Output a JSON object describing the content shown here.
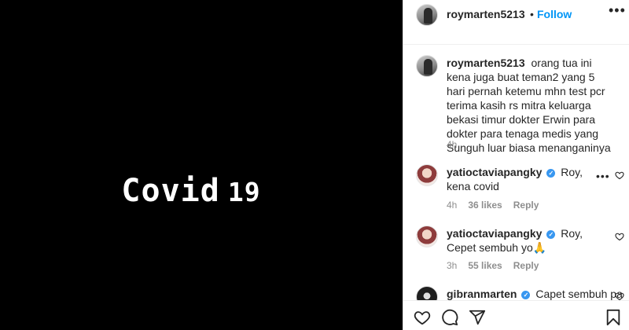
{
  "media": {
    "word": "Covid",
    "number": "19"
  },
  "header": {
    "username": "roymarten5213",
    "separator": "•",
    "follow_label": "Follow",
    "more_icon": "more-horizontal-icon"
  },
  "caption": {
    "username": "roymarten5213",
    "text": "orang tua ini kena juga buat teman2 yang 5 hari pernah ketemu mhn test pcr terima kasih rs mitra keluarga bekasi timur dokter Erwin para dokter para tenaga medis yang Sunguh luar biasa menanganinya",
    "time": "4h"
  },
  "comments": [
    {
      "username": "yatioctaviapangky",
      "verified": true,
      "text": "Roy, kena covid",
      "time": "4h",
      "likes": "36 likes",
      "reply": "Reply"
    },
    {
      "username": "yatioctaviapangky",
      "verified": true,
      "text": "Roy, Cepet sembuh yo🙏",
      "time": "3h",
      "likes": "55 likes",
      "reply": "Reply"
    },
    {
      "username": "gibranmarten",
      "verified": true,
      "text": "Capet sembuh pa",
      "time": "",
      "likes": "",
      "reply": ""
    }
  ],
  "action_icons": [
    "heart-icon",
    "comment-icon",
    "share-icon",
    "bookmark-icon"
  ],
  "colors": {
    "accent": "#0095f6",
    "verified": "#3897f0",
    "muted": "#8e8e8e",
    "media_bg": "#000000"
  }
}
